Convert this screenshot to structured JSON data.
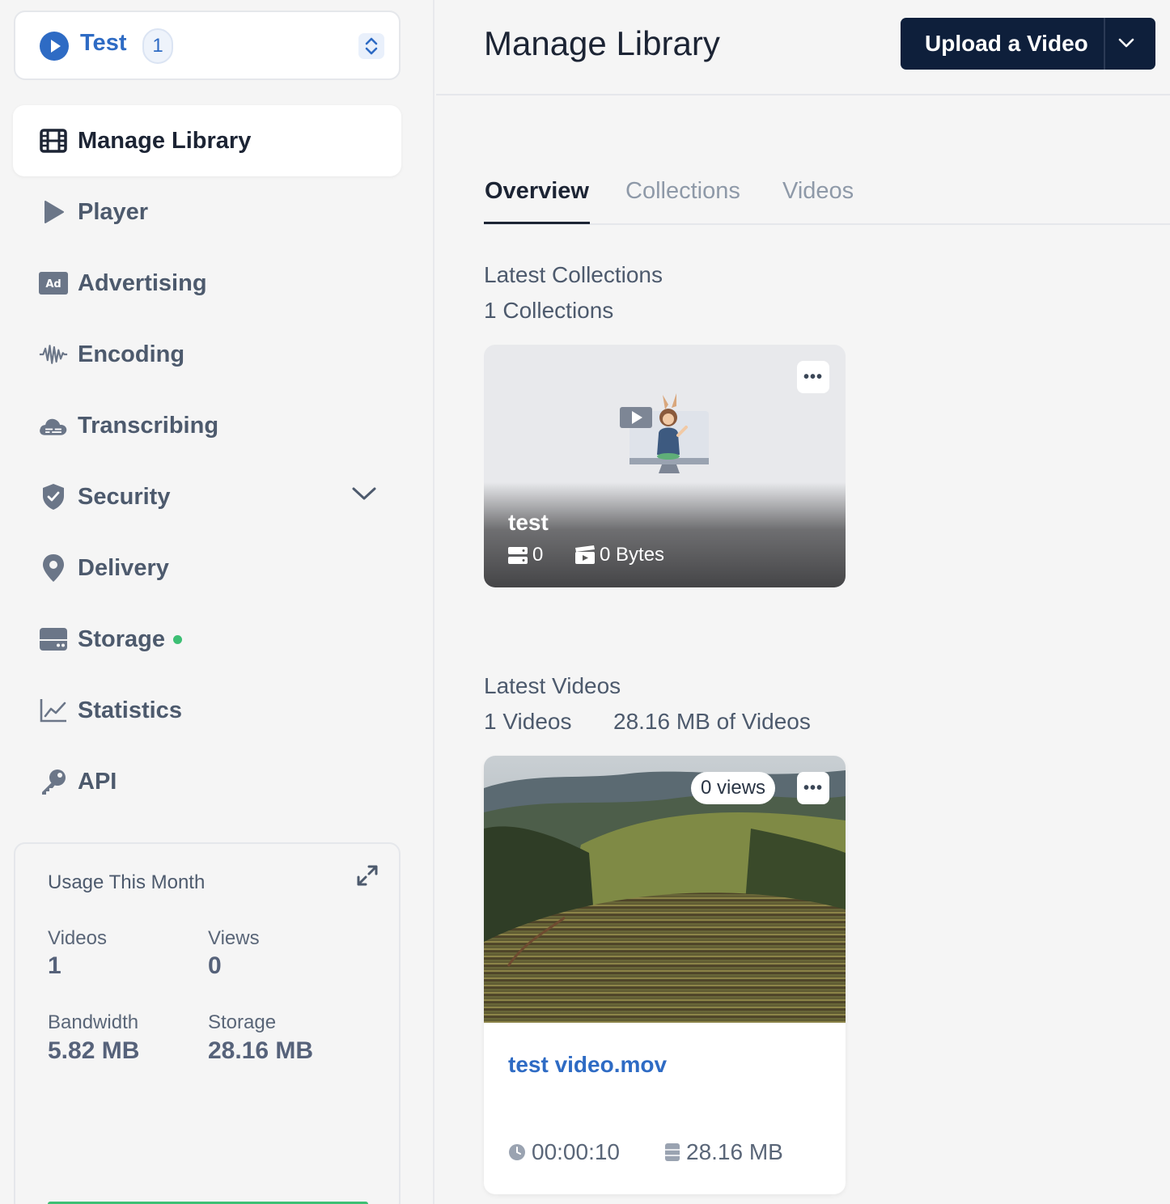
{
  "library": {
    "name": "Test",
    "count": "1"
  },
  "nav": {
    "items": [
      {
        "label": "Manage Library",
        "icon": "film-icon",
        "active": true
      },
      {
        "label": "Player",
        "icon": "play-icon"
      },
      {
        "label": "Advertising",
        "icon": "ad-icon"
      },
      {
        "label": "Encoding",
        "icon": "waveform-icon"
      },
      {
        "label": "Transcribing",
        "icon": "cloud-captions-icon"
      },
      {
        "label": "Security",
        "icon": "shield-icon"
      },
      {
        "label": "Delivery",
        "icon": "map-pin-icon"
      },
      {
        "label": "Storage",
        "icon": "hard-drive-icon"
      },
      {
        "label": "Statistics",
        "icon": "chart-line-icon"
      },
      {
        "label": "API",
        "icon": "key-icon"
      }
    ]
  },
  "usage": {
    "title": "Usage This Month",
    "videos_label": "Videos",
    "videos_value": "1",
    "views_label": "Views",
    "views_value": "0",
    "bandwidth_label": "Bandwidth",
    "bandwidth_value": "5.82 MB",
    "storage_label": "Storage",
    "storage_value": "28.16 MB"
  },
  "header": {
    "title": "Manage Library",
    "upload_label": "Upload a Video"
  },
  "tabs": [
    "Overview",
    "Collections",
    "Videos"
  ],
  "collections_section": {
    "title": "Latest Collections",
    "count_text": "1 Collections",
    "card": {
      "name": "test",
      "video_count": "0",
      "size": "0 Bytes"
    }
  },
  "videos_section": {
    "title": "Latest Videos",
    "count_text": "1 Videos",
    "size_text": "28.16 MB of Videos",
    "card": {
      "views": "0 views",
      "title": "test video.mov",
      "duration": "00:00:10",
      "size": "28.16 MB"
    }
  },
  "colors": {
    "accent": "#2e6bc4",
    "primary_button": "#0e1f3b",
    "status_green": "#3dbf74"
  }
}
